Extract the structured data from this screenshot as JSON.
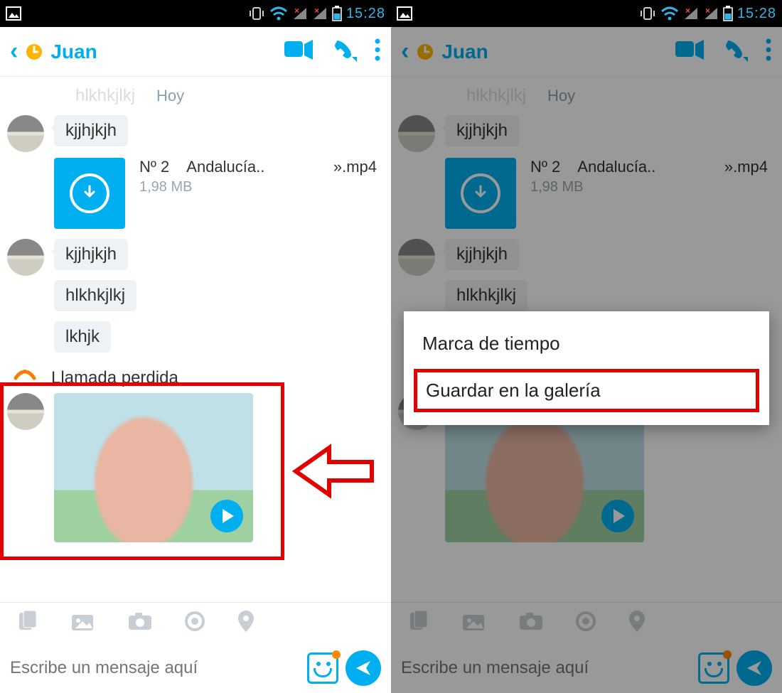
{
  "status": {
    "time": "15:28"
  },
  "header": {
    "contact": "Juan"
  },
  "day": {
    "ghost": "hlkhkjlkj",
    "label": "Hoy"
  },
  "msgs": {
    "m1": "kjjhjkjh",
    "m2": "kjjhjkjh",
    "m3": "hlkhkjlkj",
    "m4": "lkhjk"
  },
  "file": {
    "num": "Nº 2",
    "name": "Andalucía..",
    "ext": "».mp4",
    "size": "1,98 MB"
  },
  "missed": "Llamada perdida",
  "input": {
    "placeholder": "Escribe un mensaje aquí"
  },
  "popup": {
    "opt1": "Marca de tiempo",
    "opt2": "Guardar en la galería"
  }
}
